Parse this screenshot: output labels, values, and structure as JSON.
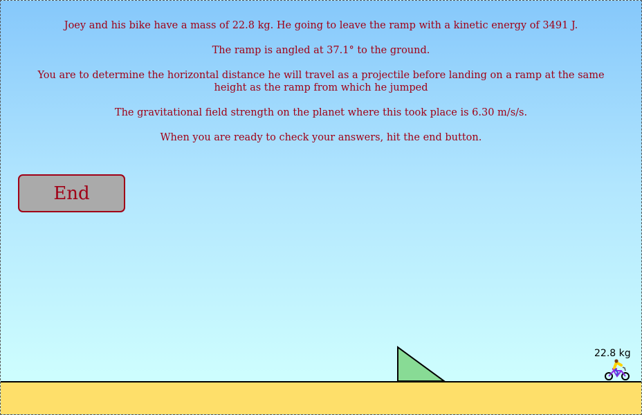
{
  "instructions": {
    "line1": "Joey and his bike have a mass of 22.8 kg. He going to leave the ramp with a kinetic energy of 3491 J.",
    "line2": "The ramp is angled at 37.1° to the ground.",
    "line3": "You are to determine the horizontal distance he will travel as a projectile before landing on a ramp at the same height as the ramp from which he jumped",
    "line4": "The gravitational field strength on the planet where this took place is 6.30 m/s/s.",
    "line5": "When you are ready to check your answers, hit the end button."
  },
  "controls": {
    "end_label": "End"
  },
  "rider": {
    "mass_label": "22.8 kg",
    "icon": "bicycle-rider-icon"
  },
  "colors": {
    "text": "#a00016",
    "ramp": "#88db95",
    "ground": "#fedf6a",
    "sky_top": "#86c8fb",
    "sky_bottom": "#cdfdfe",
    "button": "#aaaaaa"
  }
}
